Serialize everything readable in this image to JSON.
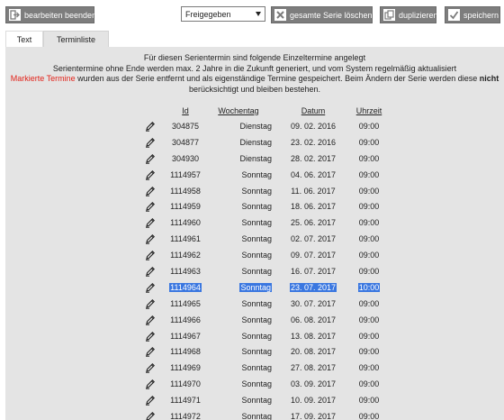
{
  "toolbar": {
    "end_label": "bearbeiten beenden",
    "status_value": "Freigegeben",
    "delete_label": "gesamte Serie löschen",
    "duplicate_label": "duplizieren",
    "save_label": "speichern",
    "icons": {
      "end": "exit-icon",
      "delete": "close-icon",
      "duplicate": "copy-icon",
      "save": "save-icon"
    }
  },
  "tabs": [
    {
      "label": "Text",
      "active": true
    },
    {
      "label": "Terminliste",
      "active": false
    }
  ],
  "info": {
    "line1": "Für diesen Serientermin sind folgende Einzeltermine angelegt",
    "line2": "Serientermine ohne Ende werden max. 2 Jahre in die Zukunft generiert, und vom System regelmäßig aktualisiert",
    "line3_red": "Markierte Termine",
    "line3_rest": " wurden aus der Serie entfernt und als eigenständige Termine gespeichert. Beim Ändern der Serie werden diese ",
    "line3_bold": "nicht",
    "line4": "berücksichtigt und bleiben bestehen."
  },
  "columns": {
    "id": "Id",
    "weekday": "Wochentag",
    "date": "Datum",
    "time": "Uhrzeit"
  },
  "rows": [
    {
      "id": "304875",
      "weekday": "Dienstag",
      "date": "09. 02. 2016",
      "time": "09:00",
      "selected": false
    },
    {
      "id": "304877",
      "weekday": "Dienstag",
      "date": "23. 02. 2016",
      "time": "09:00",
      "selected": false
    },
    {
      "id": "304930",
      "weekday": "Dienstag",
      "date": "28. 02. 2017",
      "time": "09:00",
      "selected": false
    },
    {
      "id": "1114957",
      "weekday": "Sonntag",
      "date": "04. 06. 2017",
      "time": "09:00",
      "selected": false
    },
    {
      "id": "1114958",
      "weekday": "Sonntag",
      "date": "11. 06. 2017",
      "time": "09:00",
      "selected": false
    },
    {
      "id": "1114959",
      "weekday": "Sonntag",
      "date": "18. 06. 2017",
      "time": "09:00",
      "selected": false
    },
    {
      "id": "1114960",
      "weekday": "Sonntag",
      "date": "25. 06. 2017",
      "time": "09:00",
      "selected": false
    },
    {
      "id": "1114961",
      "weekday": "Sonntag",
      "date": "02. 07. 2017",
      "time": "09:00",
      "selected": false
    },
    {
      "id": "1114962",
      "weekday": "Sonntag",
      "date": "09. 07. 2017",
      "time": "09:00",
      "selected": false
    },
    {
      "id": "1114963",
      "weekday": "Sonntag",
      "date": "16. 07. 2017",
      "time": "09:00",
      "selected": false
    },
    {
      "id": "1114964",
      "weekday": "Sonntag",
      "date": "23. 07. 2017",
      "time": "10:00",
      "selected": true
    },
    {
      "id": "1114965",
      "weekday": "Sonntag",
      "date": "30. 07. 2017",
      "time": "09:00",
      "selected": false
    },
    {
      "id": "1114966",
      "weekday": "Sonntag",
      "date": "06. 08. 2017",
      "time": "09:00",
      "selected": false
    },
    {
      "id": "1114967",
      "weekday": "Sonntag",
      "date": "13. 08. 2017",
      "time": "09:00",
      "selected": false
    },
    {
      "id": "1114968",
      "weekday": "Sonntag",
      "date": "20. 08. 2017",
      "time": "09:00",
      "selected": false
    },
    {
      "id": "1114969",
      "weekday": "Sonntag",
      "date": "27. 08. 2017",
      "time": "09:00",
      "selected": false
    },
    {
      "id": "1114970",
      "weekday": "Sonntag",
      "date": "03. 09. 2017",
      "time": "09:00",
      "selected": false
    },
    {
      "id": "1114971",
      "weekday": "Sonntag",
      "date": "10. 09. 2017",
      "time": "09:00",
      "selected": false
    },
    {
      "id": "1114972",
      "weekday": "Sonntag",
      "date": "17. 09. 2017",
      "time": "09:00",
      "selected": false
    }
  ]
}
